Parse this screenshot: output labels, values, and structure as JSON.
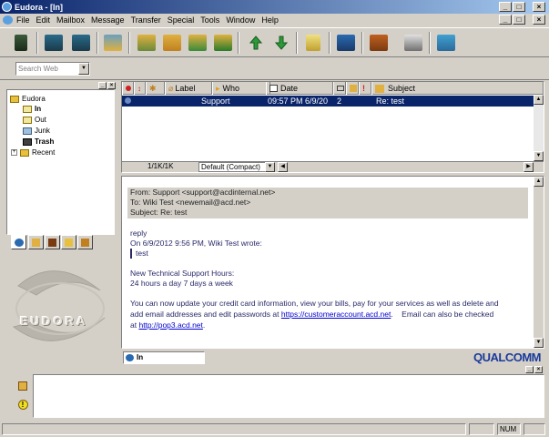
{
  "window": {
    "title": "Eudora - [In]"
  },
  "menu": [
    "File",
    "Edit",
    "Mailbox",
    "Message",
    "Transfer",
    "Special",
    "Tools",
    "Window",
    "Help"
  ],
  "search": {
    "placeholder": "Search Web"
  },
  "tree": [
    {
      "label": "Eudora",
      "bold": false
    },
    {
      "label": "In",
      "bold": true
    },
    {
      "label": "Out",
      "bold": false
    },
    {
      "label": "Junk",
      "bold": false
    },
    {
      "label": "Trash",
      "bold": true
    },
    {
      "label": "Recent",
      "bold": false
    }
  ],
  "logo": {
    "text": "EUDORA"
  },
  "columns": {
    "label": "Label",
    "who": "Who",
    "date": "Date",
    "subject": "Subject"
  },
  "message_row": {
    "who": "Support",
    "date": "09:57 PM 6/9/20",
    "size": "2",
    "subject": "Re: test"
  },
  "list_status": {
    "counts": "1/1K/1K",
    "view": "Default (Compact)"
  },
  "message": {
    "from": "From: Support <support@acdinternal.net>",
    "to": "To: Wiki Test <newemail@acd.net>",
    "subject": "Subject: Re: test",
    "reply": "reply",
    "quote_intro": "On 6/9/2012 9:56 PM, Wiki Test wrote:",
    "quote": "test",
    "hours_title": "New Technical Support Hours:",
    "hours": "24 hours a day 7 days a week",
    "para1": "You can now update your credit card information, view your bills, pay for your services as well as delete and",
    "para2_pre": "add email addresses and edit passwords at",
    "link1": "https://customeraccount.acd.net",
    "para2_post": ".    Email can also be checked",
    "para3_pre": "at",
    "link2": "http://pop3.acd.net",
    "para3_post": "."
  },
  "mailbox_field": "In",
  "brand": "QUALCOMM",
  "status": {
    "num": "NUM"
  },
  "colors": {
    "title_start": "#0a246a",
    "title_end": "#a6caf0",
    "selection": "#0a246a",
    "body_text": "#2a2a6a",
    "link": "#0000cc"
  }
}
